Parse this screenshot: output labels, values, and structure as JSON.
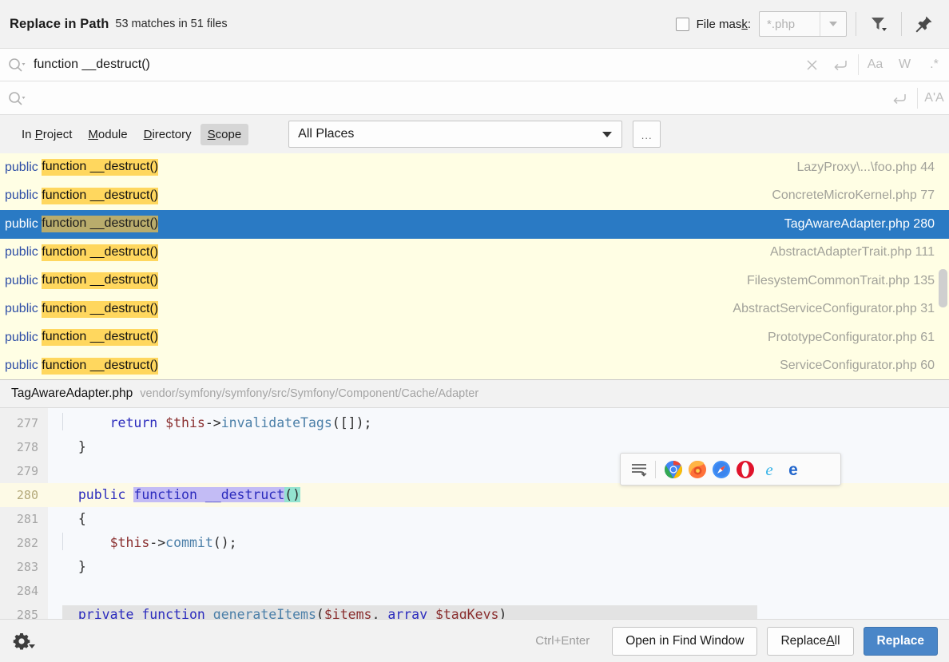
{
  "window": {
    "title": "Replace in Path",
    "subtitle": "53 matches in 51 files"
  },
  "filemask": {
    "label_pre": "File mas",
    "label_accel": "k",
    "label_post": ":",
    "checked": false,
    "value": "*.php",
    "dropdown_icon": "chevron-down-icon"
  },
  "toolbar": {
    "filter_icon": "filter-icon",
    "pin_icon": "pin-icon"
  },
  "search": {
    "icon": "search-icon",
    "value": "function __destruct()",
    "placeholder": "",
    "clear_icon": "close-icon",
    "history_icon": "history-return-icon",
    "toggles": [
      {
        "name": "match-case-toggle",
        "label": "Aa"
      },
      {
        "name": "words-toggle",
        "label": "W"
      },
      {
        "name": "regex-toggle",
        "label": ".*"
      }
    ]
  },
  "replace": {
    "icon": "search-icon",
    "value": "",
    "placeholder": "",
    "history_icon": "history-return-icon",
    "preserve_case_label": "A'A"
  },
  "scope": {
    "tabs": [
      {
        "name": "in-project",
        "pre": "In ",
        "accel": "P",
        "post": "roject",
        "active": false
      },
      {
        "name": "module",
        "pre": "",
        "accel": "M",
        "post": "odule",
        "active": false
      },
      {
        "name": "directory",
        "pre": "",
        "accel": "D",
        "post": "irectory",
        "active": false
      },
      {
        "name": "scope",
        "pre": "",
        "accel": "S",
        "post": "cope",
        "active": true
      }
    ],
    "places_value": "All Places",
    "ellipsis_label": "..."
  },
  "results": [
    {
      "modifier": "public",
      "match": "function __destruct()",
      "file": "LazyProxy\\...\\foo.php",
      "line": "44",
      "selected": false
    },
    {
      "modifier": "public",
      "match": "function __destruct()",
      "file": "ConcreteMicroKernel.php",
      "line": "77",
      "selected": false
    },
    {
      "modifier": "public",
      "match": "function __destruct()",
      "file": "TagAwareAdapter.php",
      "line": "280",
      "selected": true
    },
    {
      "modifier": "public",
      "match": "function __destruct()",
      "file": "AbstractAdapterTrait.php",
      "line": "111",
      "selected": false
    },
    {
      "modifier": "public",
      "match": "function __destruct()",
      "file": "FilesystemCommonTrait.php",
      "line": "135",
      "selected": false
    },
    {
      "modifier": "public",
      "match": "function __destruct()",
      "file": "AbstractServiceConfigurator.php",
      "line": "31",
      "selected": false
    },
    {
      "modifier": "public",
      "match": "function __destruct()",
      "file": "PrototypeConfigurator.php",
      "line": "61",
      "selected": false
    },
    {
      "modifier": "public",
      "match": "function __destruct()",
      "file": "ServiceConfigurator.php",
      "line": "60",
      "selected": false
    }
  ],
  "preview": {
    "file": "TagAwareAdapter.php",
    "path": "vendor/symfony/symfony/src/Symfony/Component/Cache/Adapter",
    "lines": [
      {
        "num": "277",
        "current": false
      },
      {
        "num": "278",
        "current": false
      },
      {
        "num": "279",
        "current": false
      },
      {
        "num": "280",
        "current": true
      },
      {
        "num": "281",
        "current": false
      },
      {
        "num": "282",
        "current": false
      },
      {
        "num": "283",
        "current": false
      },
      {
        "num": "284",
        "current": false
      },
      {
        "num": "285",
        "current": false
      }
    ],
    "code": {
      "l277_return": "return ",
      "l277_this": "$this",
      "l277_arrow": "->",
      "l277_call": "invalidateTags",
      "l277_tail": "([]);",
      "l278": "}",
      "l280_public": "public ",
      "l280_sel": "function __destruct",
      "l280_parens": "()",
      "l281": "{",
      "l282_this": "$this",
      "l282_arrow": "->",
      "l282_call": "commit",
      "l282_tail": "();",
      "l283": "}",
      "l285_private": "private ",
      "l285_function": "function ",
      "l285_name": "generateItems",
      "l285_open": "(",
      "l285_items": "$items",
      "l285_comma": ", ",
      "l285_array": "array ",
      "l285_tagkeys": "$tagKeys",
      "l285_close": ")"
    }
  },
  "browser_popup": {
    "wrap_icon": "soft-wrap-icon",
    "browsers": [
      {
        "name": "chrome-icon",
        "label": "Chrome"
      },
      {
        "name": "firefox-icon",
        "label": "Firefox"
      },
      {
        "name": "safari-icon",
        "label": "Safari"
      },
      {
        "name": "opera-icon",
        "label": "Opera"
      },
      {
        "name": "internet-explorer-icon",
        "label": "Internet Explorer"
      },
      {
        "name": "edge-icon",
        "label": "Edge"
      }
    ]
  },
  "bottom": {
    "settings_icon": "gear-icon",
    "shortcut": "Ctrl+Enter",
    "open_in_find_window": "Open in Find Window",
    "replace_all_pre": "Replace ",
    "replace_all_accel": "A",
    "replace_all_post": "ll",
    "replace": "Replace"
  },
  "colors": {
    "accent": "#4a86c8",
    "selection": "#2a7ac4",
    "results_bg": "#fffee4",
    "highlight": "#ffd75e"
  }
}
